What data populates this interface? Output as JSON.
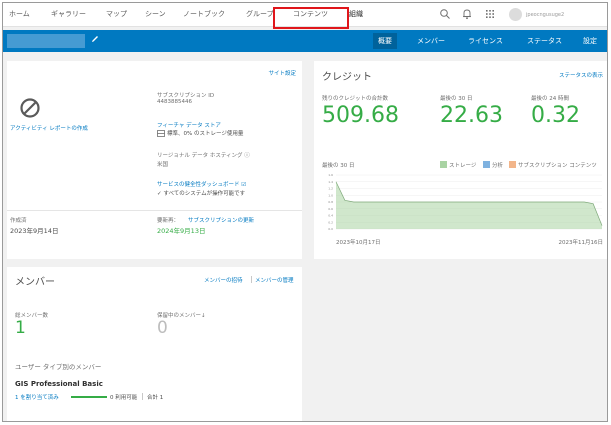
{
  "nav": {
    "items": [
      "ホーム",
      "ギャラリー",
      "マップ",
      "シーン",
      "ノートブック",
      "グループ",
      "コンテンツ",
      "組織"
    ],
    "user_name": "jpeocngusuge2"
  },
  "orgbar": {
    "tabs": [
      "概要",
      "メンバー",
      "ライセンス",
      "ステータス",
      "設定"
    ]
  },
  "site": {
    "settings_link": "サイト設定",
    "activity_report": "アクティビティ レポートの作成",
    "subscription_id_label": "サブスクリプション ID",
    "subscription_id": "4483885446",
    "feature_store_link": "フィーチャ データ ストア",
    "feature_store_detail": "標準、0% のストレージ使用量",
    "region_label": "リージョナル データ ホスティング ⓘ",
    "region_value": "米国",
    "health_link": "サービスの健全性ダッシュボード ☑",
    "health_status": "✓ すべてのシステムが操作可能です",
    "created_label": "作成済",
    "created_value": "2023年9月14日",
    "renewal_label": "要新再：",
    "renewal_link": "サブスクリプションの更新",
    "renewal_date": "2024年9月13日"
  },
  "credits": {
    "title": "クレジット",
    "status_link": "ステータスの表示",
    "total_label": "残りのクレジットの合計数",
    "total_value": "509.68",
    "last30_label": "最後の 30 日",
    "last30_value": "22.63",
    "last24_label": "最後の 24 時間",
    "last24_value": "0.32",
    "chart_period": "最後の 30 日",
    "legend": [
      "ストレージ",
      "分析",
      "サブスクリプション コンテンツ"
    ],
    "legend_colors": [
      "#a9d3a3",
      "#7fb2e0",
      "#f2b58a"
    ],
    "x_start": "2023年10月17日",
    "x_end": "2023年11月16日",
    "y_ticks": [
      "1.6",
      "1.4",
      "1.2",
      "1.0",
      "0.8",
      "0.6",
      "0.4",
      "0.2",
      "0.0"
    ]
  },
  "chart_data": {
    "type": "area",
    "x": [
      "2023-10-17",
      "2023-10-18",
      "2023-10-19",
      "2023-11-14",
      "2023-11-15",
      "2023-11-16"
    ],
    "series": [
      {
        "name": "ストレージ",
        "values": [
          1.4,
          0.85,
          0.8,
          0.8,
          0.75,
          0.1
        ]
      }
    ],
    "ylim": [
      0,
      1.6
    ],
    "grid": true,
    "legend_position": "top-right"
  },
  "members": {
    "title": "メンバー",
    "invite_link": "メンバーの招待",
    "manage_link": "メンバーの管理",
    "total_label": "総メンバー数",
    "total_value": "1",
    "pending_label": "保留中のメンバー↓",
    "pending_value": "0",
    "by_type_label": "ユーザー タイプ別のメンバー",
    "type_name": "GIS Professional Basic",
    "assigned": "1 を割り当て済み",
    "available": "0 利用可能",
    "total": "合計 1"
  }
}
